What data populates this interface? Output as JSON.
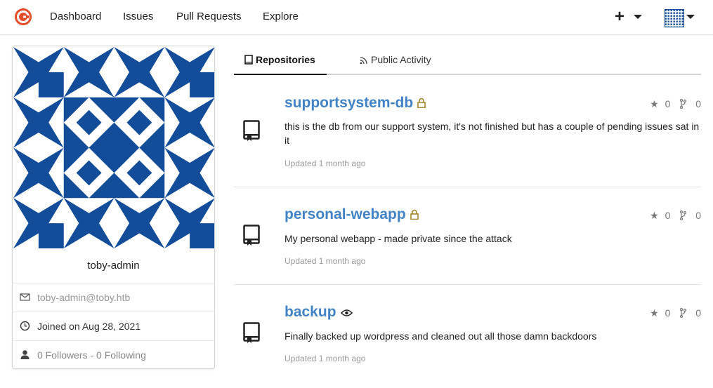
{
  "nav": {
    "items": [
      {
        "label": "Dashboard"
      },
      {
        "label": "Issues"
      },
      {
        "label": "Pull Requests"
      },
      {
        "label": "Explore"
      }
    ],
    "plus": "+",
    "brand_color": "#e34c26"
  },
  "profile": {
    "username": "toby-admin",
    "email": "toby-admin@toby.htb",
    "joined": "Joined on Aug 28, 2021",
    "followers": "0 Followers",
    "separator": " - ",
    "following": "0 Following",
    "avatar_color": "#134d9a"
  },
  "tabs": [
    {
      "label": "Repositories",
      "icon": "book-icon",
      "active": true
    },
    {
      "label": "Public Activity",
      "icon": "rss-icon",
      "active": false
    }
  ],
  "repos": [
    {
      "name": "supportsystem-db",
      "badge": "lock-icon",
      "description": "this is the db from our support system, it's not finished but has a couple of pending issues sat in it",
      "updated": "Updated 1 month ago",
      "stars": "0",
      "forks": "0"
    },
    {
      "name": "personal-webapp",
      "badge": "lock-icon",
      "description": "My personal webapp - made private since the attack",
      "updated": "Updated 1 month ago",
      "stars": "0",
      "forks": "0"
    },
    {
      "name": "backup",
      "badge": "eye-icon",
      "description": "Finally backed up wordpress and cleaned out all those damn backdoors",
      "updated": "Updated 1 month ago",
      "stars": "0",
      "forks": "0"
    }
  ]
}
